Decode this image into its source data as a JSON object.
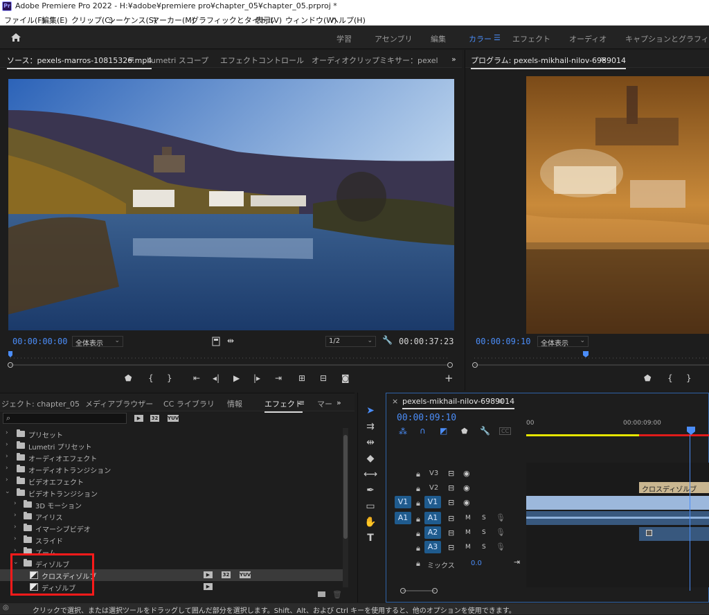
{
  "window": {
    "app_icon": "Pr",
    "title": "Adobe Premiere Pro 2022 - H:¥adobe¥premiere pro¥chapter_05¥chapter_05.prproj *"
  },
  "menubar": [
    "ファイル(F)",
    "編集(E)",
    "クリップ(C)",
    "シーケンス(S)",
    "マーカー(M)",
    "グラフィックとタイトル",
    "表示(V)",
    "ウィンドウ(W)",
    "ヘルプ(H)"
  ],
  "workspaces": {
    "items": [
      "学習",
      "アセンブリ",
      "編集",
      "カラー",
      "エフェクト",
      "オーディオ",
      "キャプションとグラフィック"
    ],
    "active": "カラー",
    "menu_icon": "☰"
  },
  "source_panel": {
    "tabs": [
      "ソース：pexels-marros-10815326.mp4",
      "Lumetri スコープ",
      "エフェクトコントロール",
      "オーディオクリップミキサー：pexels-mikhai"
    ],
    "menu_icon": "≡",
    "overflow": "»",
    "timecode_in": "00:00:00:00",
    "zoom": "全体表示",
    "resolution": "1/2",
    "duration": "00:00:37:23",
    "add": "+"
  },
  "program_panel": {
    "tab": "プログラム: pexels-mikhail-nilov-6989014",
    "menu_icon": "≡",
    "timecode": "00:00:09:10",
    "zoom": "全体表示"
  },
  "project_panel": {
    "tabs": [
      "ジェクト: chapter_05",
      "メディアブラウザー",
      "CC ライブラリ",
      "情報",
      "エフェクト",
      "マー"
    ],
    "active_tab": "エフェクト",
    "menu_icon": "≡",
    "overflow": "»",
    "search_icon": "⌕",
    "filter_badges": [
      "▶",
      "32",
      "YUV"
    ],
    "items": [
      {
        "label": "プリセット",
        "level": 0,
        "type": "preset-folder"
      },
      {
        "label": "Lumetri プリセット",
        "level": 0,
        "type": "preset-folder"
      },
      {
        "label": "オーディオエフェクト",
        "level": 0,
        "type": "folder"
      },
      {
        "label": "オーディオトランジション",
        "level": 0,
        "type": "folder"
      },
      {
        "label": "ビデオエフェクト",
        "level": 0,
        "type": "folder"
      },
      {
        "label": "ビデオトランジション",
        "level": 0,
        "type": "folder-open"
      },
      {
        "label": "3D モーション",
        "level": 1,
        "type": "folder"
      },
      {
        "label": "アイリス",
        "level": 1,
        "type": "folder"
      },
      {
        "label": "イマーシブビデオ",
        "level": 1,
        "type": "folder"
      },
      {
        "label": "スライド",
        "level": 1,
        "type": "folder"
      },
      {
        "label": "ズーム",
        "level": 1,
        "type": "folder"
      },
      {
        "label": "ディゾルブ",
        "level": 1,
        "type": "folder-open"
      },
      {
        "label": "クロスディゾルブ",
        "level": 2,
        "type": "effect",
        "selected": true,
        "badges": [
          "▶",
          "32",
          "YUV"
        ]
      },
      {
        "label": "ディゾルブ",
        "level": 2,
        "type": "effect",
        "badges": [
          "▶"
        ]
      }
    ]
  },
  "timeline": {
    "sequence": "pexels-mikhail-nilov-6989014",
    "close": "×",
    "menu_icon": "≡",
    "timecode": "00:00:09:10",
    "ruler_labels": [
      "00",
      "00:00:09:00"
    ],
    "tracks": [
      {
        "id": "V3",
        "src": "",
        "kind": "video"
      },
      {
        "id": "V2",
        "src": "",
        "kind": "video"
      },
      {
        "id": "V1",
        "src": "V1",
        "kind": "video"
      },
      {
        "id": "A1",
        "src": "A1",
        "kind": "audio",
        "m": "M",
        "s": "S"
      },
      {
        "id": "A2",
        "src": "",
        "kind": "audio",
        "m": "M",
        "s": "S"
      },
      {
        "id": "A3",
        "src": "",
        "kind": "audio",
        "m": "M",
        "s": "S"
      }
    ],
    "mix_label": "ミックス",
    "mix_value": "0.0",
    "clip_label": "クロスディゾルブ"
  },
  "tools": [
    "selection-tool",
    "track-select-tool",
    "ripple-edit-tool",
    "razor-tool",
    "slip-tool",
    "pen-tool",
    "rectangle-tool",
    "hand-tool",
    "type-tool"
  ],
  "status": "クリックで選択、または選択ツールをドラッグして囲んだ部分を選択します。Shift、Alt、および Ctrl キーを使用すると、他のオプションを使用できます。",
  "colors": {
    "accent": "#4b8df8",
    "highlight_box": "#ff1a1a",
    "clip_blue": "#7fa6d6"
  }
}
